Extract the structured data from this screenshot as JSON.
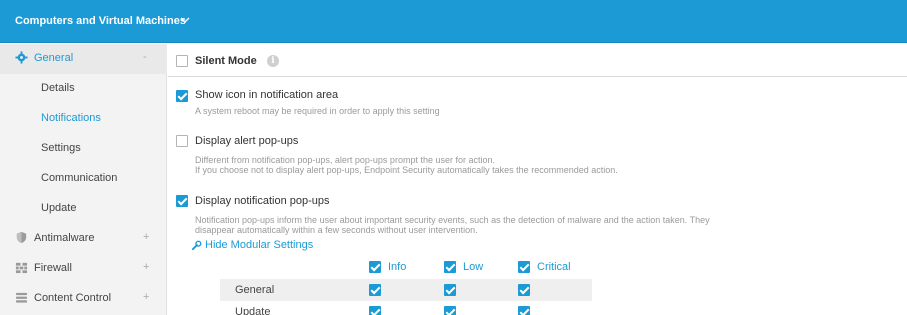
{
  "header": {
    "title": "Computers and Virtual Machines"
  },
  "sidebar": {
    "items": [
      {
        "label": "General",
        "toggle": "-"
      },
      {
        "label": "Details"
      },
      {
        "label": "Notifications"
      },
      {
        "label": "Settings"
      },
      {
        "label": "Communication"
      },
      {
        "label": "Update"
      },
      {
        "label": "Antimalware",
        "toggle": "+"
      },
      {
        "label": "Firewall",
        "toggle": "+"
      },
      {
        "label": "Content Control",
        "toggle": "+"
      }
    ]
  },
  "main": {
    "silent_mode": {
      "label": "Silent Mode",
      "checked": false
    },
    "show_icon": {
      "label": "Show icon in notification area",
      "checked": true,
      "desc": "A system reboot may be required in order to apply this setting"
    },
    "alert_popups": {
      "label": "Display alert pop-ups",
      "checked": false,
      "desc1": "Different from notification pop-ups, alert pop-ups prompt the user for action.",
      "desc2": "If you choose not to display alert pop-ups, Endpoint Security automatically takes the recommended action."
    },
    "notification_popups": {
      "label": "Display notification pop-ups",
      "checked": true,
      "desc1": "Notification pop-ups inform the user about important security events, such as the detection of malware and the action taken. They",
      "desc2": "disappear automatically within a few seconds without user intervention."
    },
    "hide_modular": "Hide Modular Settings",
    "modular_table": {
      "columns": [
        "Info",
        "Low",
        "Critical"
      ],
      "rows": [
        {
          "name": "General"
        },
        {
          "name": "Update"
        }
      ]
    }
  },
  "colors": {
    "accent": "#1c9ad6"
  }
}
